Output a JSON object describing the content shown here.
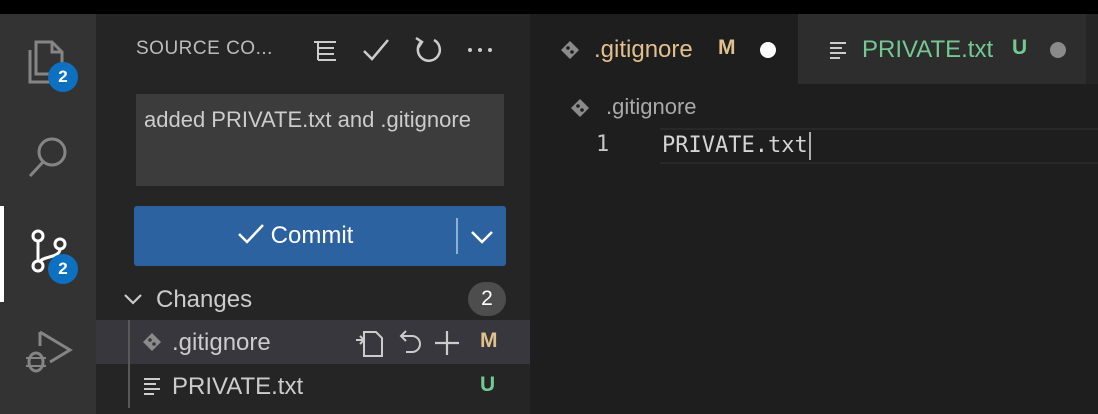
{
  "activity_bar": {
    "explorer_badge": "2",
    "scm_badge": "2"
  },
  "sidebar": {
    "title": "SOURCE CO...",
    "commit_message": "added PRIVATE.txt and .gitignore",
    "commit_label": "Commit",
    "changes": {
      "label": "Changes",
      "count": "2",
      "files": [
        {
          "name": ".gitignore",
          "status": "M",
          "status_color": "#e2c08d",
          "icon": "git-diamond-icon"
        },
        {
          "name": "PRIVATE.txt",
          "status": "U",
          "status_color": "#73c991",
          "icon": "text-lines-icon"
        }
      ]
    }
  },
  "tabs": [
    {
      "name": ".gitignore",
      "status": "M",
      "color": "#e2c08d",
      "dot_color": "#ffffff",
      "active": true
    },
    {
      "name": "PRIVATE.txt",
      "status": "U",
      "color": "#73c991",
      "dot_color": "#8a8a8a",
      "active": false
    }
  ],
  "editor": {
    "breadcrumb": ".gitignore",
    "line_number": "1",
    "line_content": "PRIVATE.txt"
  },
  "colors": {
    "accent": "#0e70c0",
    "commit_button": "#2d62a0",
    "modified": "#e2c08d",
    "untracked": "#73c991"
  }
}
